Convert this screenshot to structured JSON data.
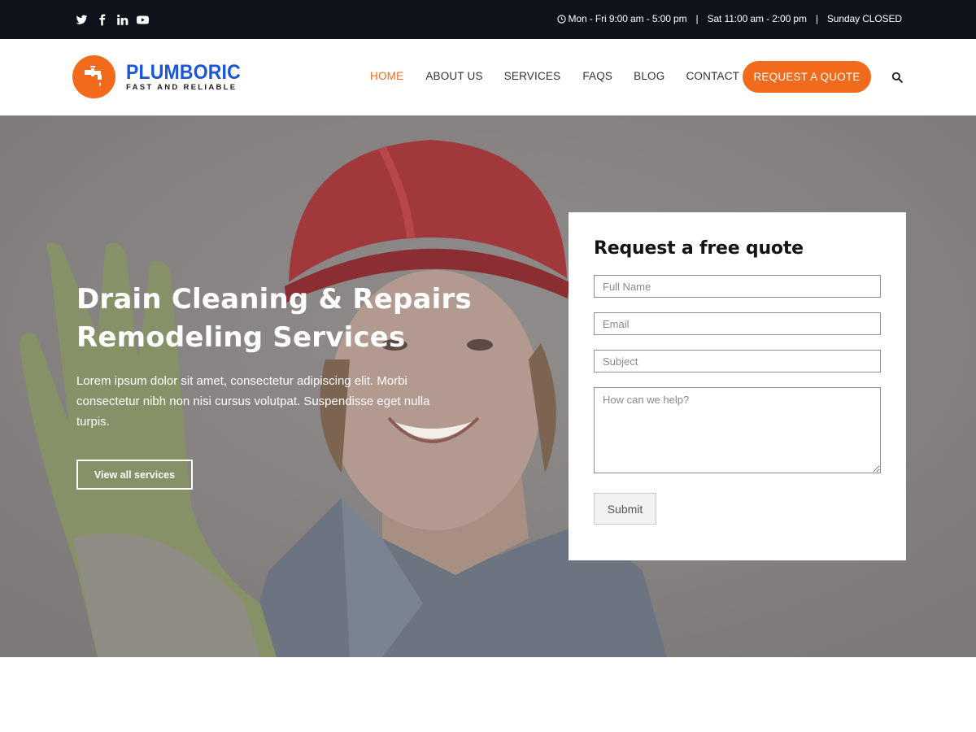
{
  "topbar": {
    "social": [
      {
        "icon": "twitter-icon"
      },
      {
        "icon": "facebook-icon"
      },
      {
        "icon": "linkedin-icon"
      },
      {
        "icon": "youtube-icon"
      }
    ],
    "hours": [
      "Mon - Fri 9:00 am - 5:00 pm",
      "Sat 11:00 am - 2:00 pm",
      "Sunday CLOSED"
    ],
    "separator": "|"
  },
  "header": {
    "brand": "PLUMBORIC",
    "tagline": "FAST AND RELIABLE",
    "nav": [
      "HOME",
      "ABOUT US",
      "SERVICES",
      "FAQS",
      "BLOG",
      "CONTACT"
    ],
    "active_nav": "HOME",
    "quote_button": "REQUEST A QUOTE"
  },
  "hero": {
    "title_line1": "Drain Cleaning & Repairs",
    "title_line2": "Remodeling Services",
    "text": "Lorem ipsum dolor sit amet, consectetur adipiscing elit. Morbi consectetur nibh non nisi cursus volutpat. Suspendisse eget nulla turpis.",
    "button": "View all services"
  },
  "quote_form": {
    "title": "Request a free quote",
    "fields": {
      "name_placeholder": "Full Name",
      "email_placeholder": "Email",
      "subject_placeholder": "Subject",
      "message_placeholder": "How can we help?"
    },
    "submit": "Submit"
  },
  "colors": {
    "accent": "#f26a1b",
    "brand_blue": "#1a56d6",
    "topbar_bg": "#0e121b",
    "hero_overlay": "#8b8787"
  }
}
